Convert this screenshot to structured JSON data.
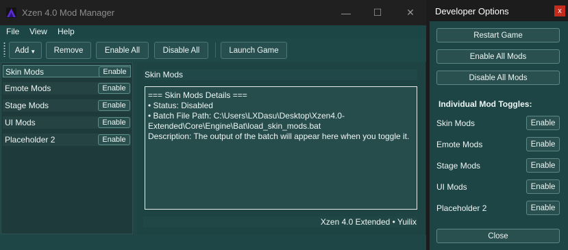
{
  "window": {
    "title": "Xzen 4.0 Mod Manager",
    "controls": {
      "minimize": "—",
      "maximize": "☐",
      "close": "✕"
    }
  },
  "menu": [
    "File",
    "View",
    "Help"
  ],
  "toolbar": {
    "add": "Add",
    "add_arrow": "▼",
    "remove": "Remove",
    "enable_all": "Enable All",
    "disable_all": "Disable All",
    "launch_game": "Launch Game"
  },
  "mods": [
    {
      "name": "Skin Mods",
      "button": "Enable",
      "selected": true
    },
    {
      "name": "Emote Mods",
      "button": "Enable",
      "selected": false
    },
    {
      "name": "Stage Mods",
      "button": "Enable",
      "selected": false
    },
    {
      "name": "UI Mods",
      "button": "Enable",
      "selected": false
    },
    {
      "name": "Placeholder 2",
      "button": "Enable",
      "selected": false
    }
  ],
  "details": {
    "title": "Skin Mods",
    "lines": [
      "=== Skin Mods Details ===",
      "",
      "• Status: Disabled",
      "• Batch File Path: C:\\Users\\LXDasu\\Desktop\\Xzen4.0-",
      "Extended\\Core\\Engine\\Bat\\load_skin_mods.bat",
      "",
      "Description: The output of the batch will appear here when you toggle it."
    ]
  },
  "footer": "Xzen 4.0 Extended  •  Yuilix",
  "dev_options": {
    "title": "Developer Options",
    "close_x": "x",
    "restart_game": "Restart Game",
    "enable_all_mods": "Enable All Mods",
    "disable_all_mods": "Disable All Mods",
    "section_heading": "Individual Mod Toggles:",
    "toggles": [
      {
        "name": "Skin Mods",
        "button": "Enable"
      },
      {
        "name": "Emote Mods",
        "button": "Enable"
      },
      {
        "name": "Stage Mods",
        "button": "Enable"
      },
      {
        "name": "UI Mods",
        "button": "Enable"
      },
      {
        "name": "Placeholder 2",
        "button": "Enable"
      }
    ],
    "close_button": "Close"
  },
  "colors": {
    "window_bg": "#1f4545",
    "titlebar_bg": "#202020",
    "button_border": "#5c8987",
    "close_red": "#c42b1c",
    "logo_purple": "#5b2bd6"
  }
}
